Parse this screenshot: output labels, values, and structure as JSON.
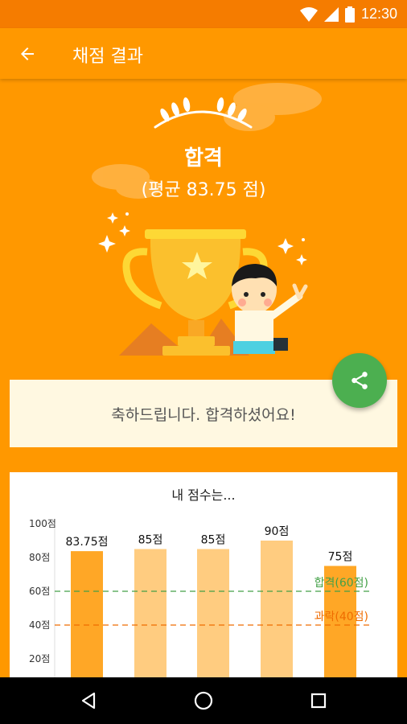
{
  "status_bar": {
    "time": "12:30"
  },
  "app_bar": {
    "title": "채점 결과"
  },
  "hero": {
    "result": "합격",
    "average": "(평균 83.75 점)"
  },
  "message": {
    "text": "축하드립니다. 합격하셨어요!"
  },
  "colors": {
    "primary": "#FF9800",
    "primary_dark": "#F57C00",
    "fab": "#4CAF50",
    "pass_line": "#43A047",
    "fail_line": "#EF6C00"
  },
  "chart_data": {
    "type": "bar",
    "title": "내 점수는...",
    "y_ticks": [
      "100점",
      "80점",
      "60점",
      "40점",
      "20점"
    ],
    "ylim": [
      0,
      100
    ],
    "values": [
      83.75,
      85,
      85,
      90,
      75
    ],
    "value_labels": [
      "83.75점",
      "85점",
      "85점",
      "90점",
      "75점"
    ],
    "bar_colors": [
      "#FFA726",
      "#FFCC80",
      "#FFCC80",
      "#FFCC80",
      "#FFA726"
    ],
    "pass_line": {
      "value": 60,
      "label": "합격(60점)"
    },
    "fail_line": {
      "value": 40,
      "label": "과락(40점)"
    }
  }
}
